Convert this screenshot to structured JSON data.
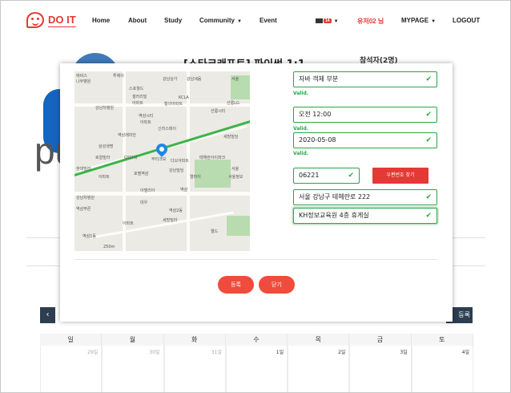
{
  "nav": {
    "logo_text": "DO IT",
    "items": [
      {
        "label": "Home"
      },
      {
        "label": "About"
      },
      {
        "label": "Study"
      },
      {
        "label": "Community"
      },
      {
        "label": "Event"
      }
    ],
    "message_count": "14",
    "user_name": "유저02 님",
    "mypage": "MYPAGE",
    "logout": "LOGOUT",
    "accent_color": "#e53935"
  },
  "background": {
    "study_title": "[스타크래프트] 파이썬 1:1",
    "participants": "참석자(2명)",
    "register_label": "등록"
  },
  "modal": {
    "map_labels": [
      "에비스",
      "투에이",
      "나무병원",
      "스포월드",
      "강남상가",
      "서울",
      "강남세움",
      "KCLA",
      "황의아파트",
      "선릉LG",
      "갤러리빌",
      "강남차병원",
      "아파트",
      "역삼시티",
      "선릉시티",
      "신라스테이",
      "아파트",
      "역삼래미안",
      "세방빌딩",
      "GS타워",
      "테헤란아이파크",
      "로얄빌라",
      "삼성생명",
      "다오아파트",
      "서울",
      "강남빌딩",
      "부티크모",
      "서울정보",
      "현대빌라",
      "호텔역삼",
      "아파트",
      "아델리아",
      "엘마이",
      "대우",
      "강남차병원",
      "역삼푸른",
      "세방빌라",
      "역삼",
      "역삼2동",
      "아파트",
      "역삼1동",
      "250m",
      "엘드"
    ],
    "fields": {
      "category": "자바 객체 부분",
      "time": "오전 12:00",
      "date": "2020-05-08",
      "postcode": "06221",
      "address": "서울 강남구 테헤란로 222",
      "address_detail": "KH정보교육원 4층 휴게실"
    },
    "valid_text": "Valid.",
    "postcode_button": "우편번호 찾기",
    "register_button": "등록",
    "close_button": "닫기",
    "valid_color": "#28a745"
  },
  "calendar": {
    "weekdays": [
      "일",
      "월",
      "화",
      "수",
      "목",
      "금",
      "토"
    ],
    "first_row": [
      "29일",
      "30일",
      "31일",
      "1일",
      "2일",
      "3일",
      "4일"
    ]
  }
}
